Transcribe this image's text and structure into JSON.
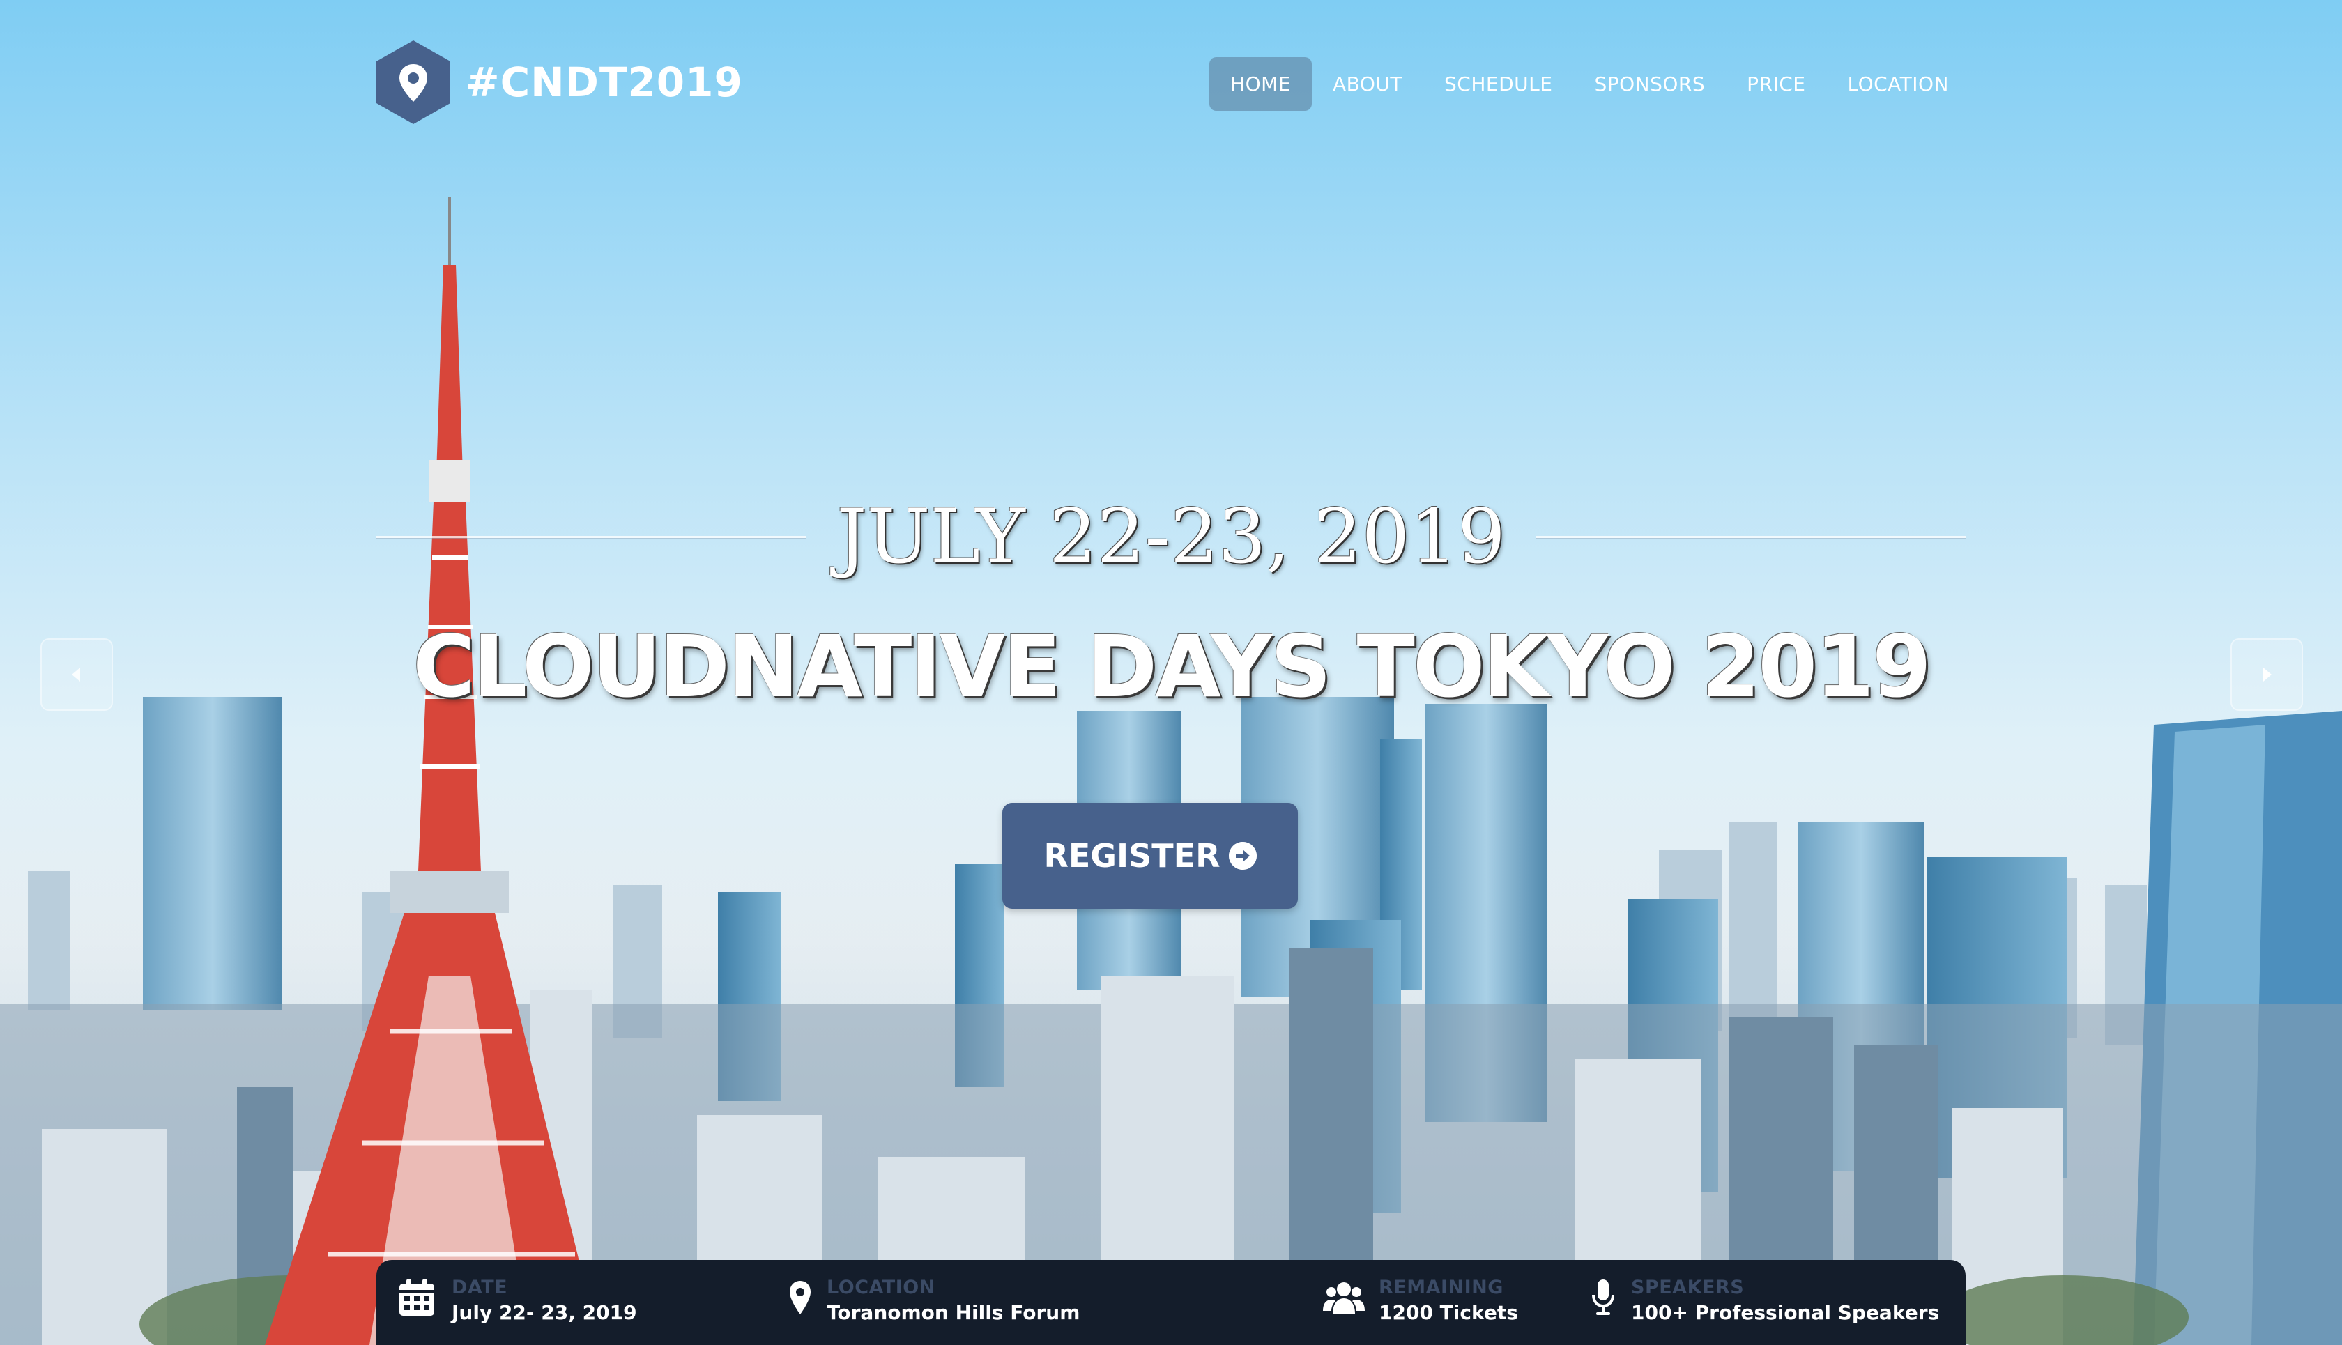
{
  "brand": {
    "logo_text": "#CNDT2019",
    "logo_icon": "location-pin-icon",
    "accent_color": "#47618c"
  },
  "nav": {
    "items": [
      {
        "label": "HOME",
        "active": true
      },
      {
        "label": "ABOUT",
        "active": false
      },
      {
        "label": "SCHEDULE",
        "active": false
      },
      {
        "label": "SPONSORS",
        "active": false
      },
      {
        "label": "PRICE",
        "active": false
      },
      {
        "label": "LOCATION",
        "active": false
      }
    ]
  },
  "hero": {
    "date": "JULY 22-23, 2019",
    "title": "CLOUDNATIVE DAYS TOKYO 2019",
    "register_label": "REGISTER",
    "register_icon": "arrow-circle-right-icon",
    "prev_icon": "chevron-left-icon",
    "next_icon": "chevron-right-icon"
  },
  "info": {
    "items": [
      {
        "icon": "calendar-icon",
        "label": "DATE",
        "value": "July 22- 23, 2019"
      },
      {
        "icon": "location-pin-icon",
        "label": "LOCATION",
        "value": "Toranomon Hills Forum"
      },
      {
        "icon": "users-icon",
        "label": "REMAINING",
        "value": "1200 Tickets"
      },
      {
        "icon": "microphone-icon",
        "label": "SPEAKERS",
        "value": "100+ Professional Speakers"
      }
    ]
  }
}
